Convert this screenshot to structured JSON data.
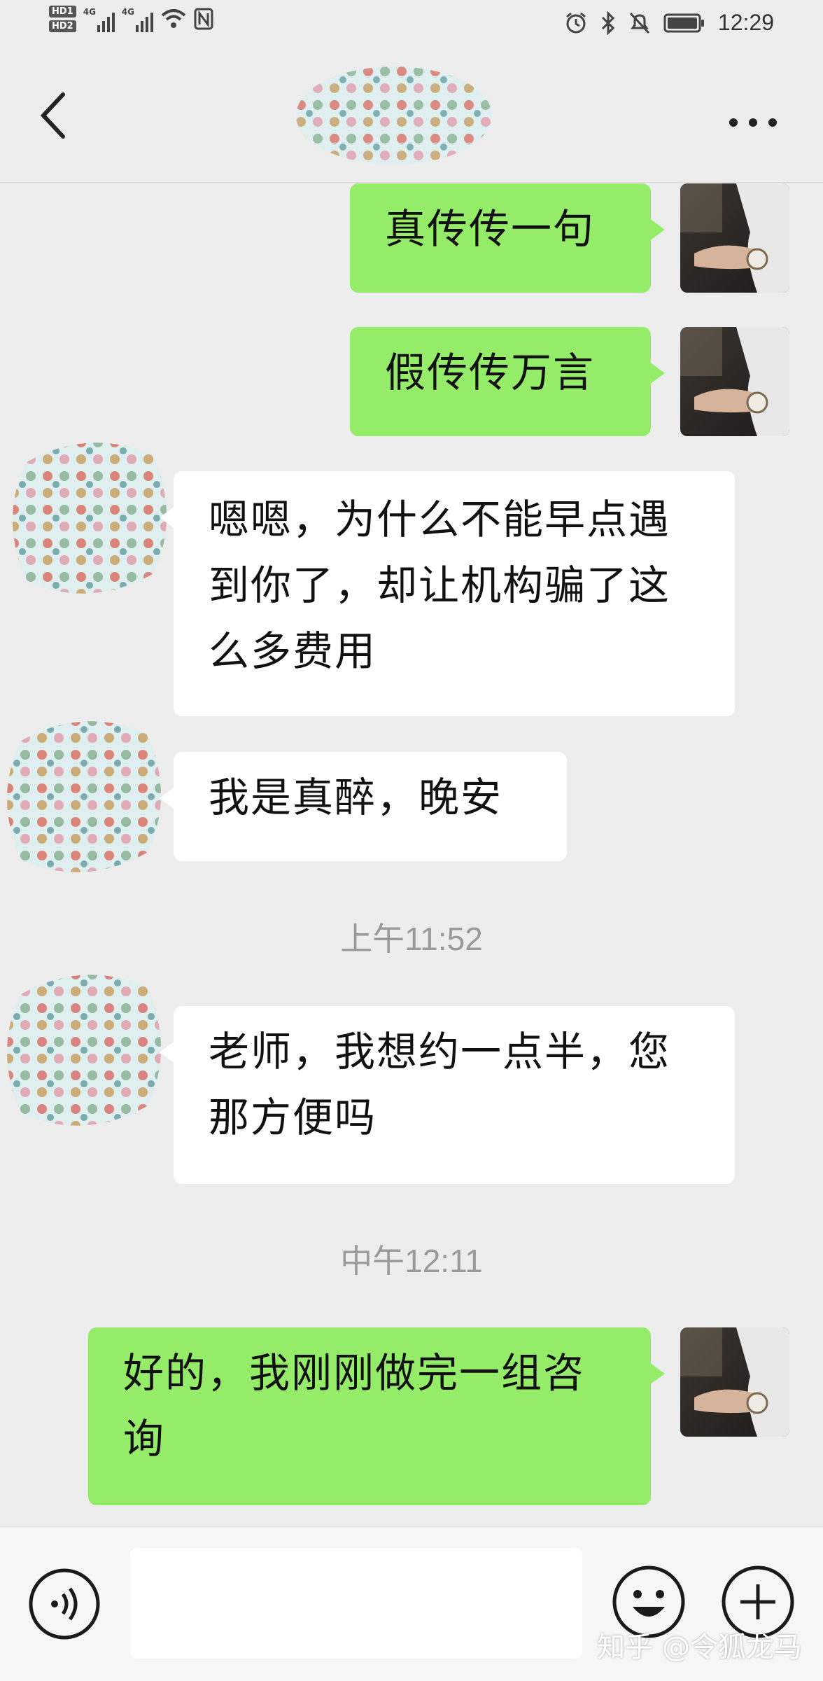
{
  "status_bar": {
    "sim1_label": "HD1",
    "sim2_label": "HD2",
    "network1": "4G",
    "network2": "4G",
    "time": "12:29",
    "icons": [
      "signal-icon",
      "wifi-icon",
      "nfc-icon",
      "alarm-icon",
      "bluetooth-icon",
      "mute-icon",
      "battery-icon"
    ]
  },
  "header": {
    "back_icon": "chevron-left-icon",
    "more_icon": "more-dots-icon"
  },
  "messages": [
    {
      "side": "me",
      "text": "真传传一句"
    },
    {
      "side": "me",
      "text": "假传传万言"
    },
    {
      "side": "other",
      "text": "嗯嗯，为什么不能早点遇到你了，却让机构骗了这么多费用"
    },
    {
      "side": "other",
      "text": "我是真醉，晚安"
    },
    {
      "type": "time",
      "text": "上午11:52"
    },
    {
      "side": "other",
      "text": "老师，我想约一点半，您那方便吗"
    },
    {
      "type": "time",
      "text": "中午12:11"
    },
    {
      "side": "me",
      "text": "好的，我刚刚做完一组咨询"
    }
  ],
  "input_bar": {
    "voice_icon": "voice-icon",
    "input_value": "",
    "emoji_icon": "emoji-icon",
    "plus_icon": "plus-icon"
  },
  "watermark": "知乎 @令狐龙马",
  "colors": {
    "background": "#ededed",
    "my_bubble": "#95ec69",
    "other_bubble": "#ffffff",
    "timestamp": "#9a9a9a"
  }
}
